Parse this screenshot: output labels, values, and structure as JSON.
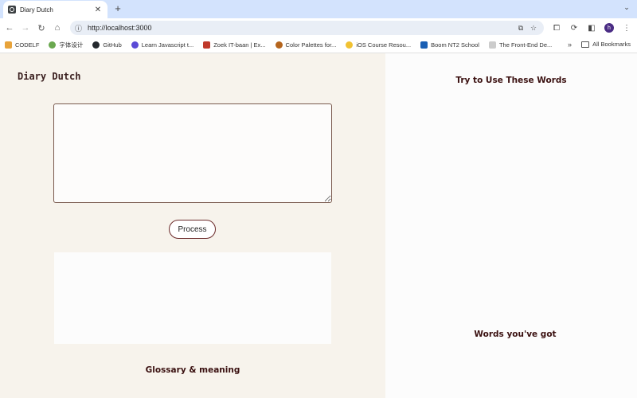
{
  "browser": {
    "tab_title": "Diary Dutch",
    "new_tab_label": "+",
    "url": "http://localhost:3000",
    "profile_initial": "h"
  },
  "bookmarks": {
    "items": [
      {
        "label": "CODELF",
        "color": "#e8a33a"
      },
      {
        "label": "字体设计",
        "color": "#6aa84f"
      },
      {
        "label": "GitHub",
        "color": "#24292e"
      },
      {
        "label": "Learn Javascript t...",
        "color": "#5b4bd6"
      },
      {
        "label": "Zoek IT-baan | Ex...",
        "color": "#c0392b"
      },
      {
        "label": "Color Palettes for...",
        "color": "#b5651d"
      },
      {
        "label": "iOS Course Resou...",
        "color": "#f1c232"
      },
      {
        "label": "Boom NT2 School",
        "color": "#1a5fb4"
      },
      {
        "label": "The Front-End De...",
        "color": "#999999"
      }
    ],
    "all_label": "All Bookmarks"
  },
  "app": {
    "title": "Diary Dutch",
    "input_value": "",
    "process_label": "Process",
    "glossary_heading": "Glossary & meaning",
    "try_heading": "Try to Use These Words",
    "got_heading": "Words you've got"
  },
  "colors": {
    "left_bg": "#f7f3ec",
    "heading": "#3a1010",
    "accent_border": "#6b2a2a"
  }
}
